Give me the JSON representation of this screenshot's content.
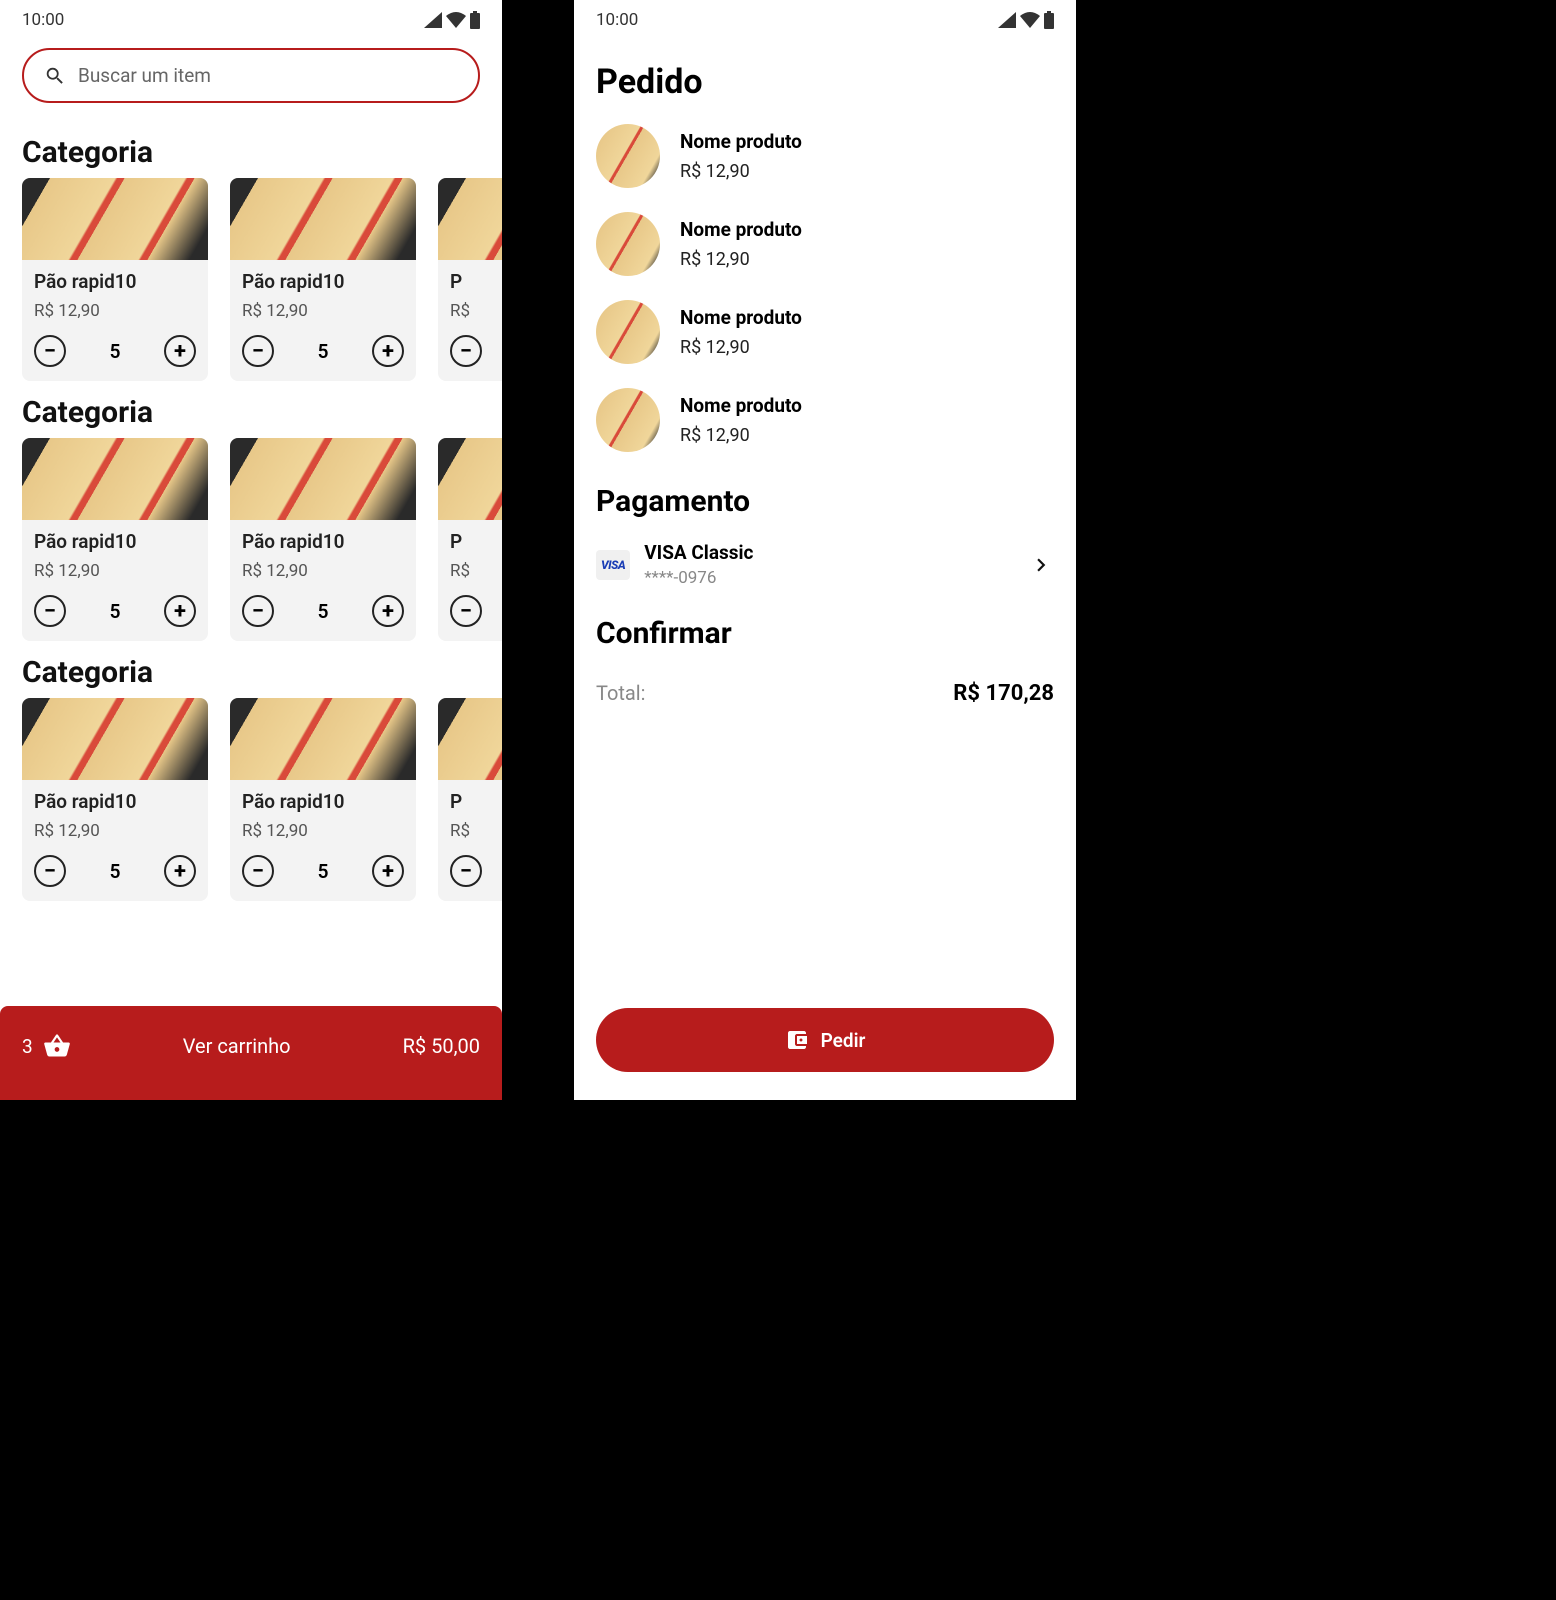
{
  "status": {
    "time": "10:00"
  },
  "search": {
    "placeholder": "Buscar um item"
  },
  "categories": [
    {
      "title": "Categoria",
      "items": [
        {
          "name": "Pão rapid10",
          "price": "R$ 12,90",
          "qty": "5"
        },
        {
          "name": "Pão rapid10",
          "price": "R$ 12,90",
          "qty": "5"
        },
        {
          "name": "P",
          "price": "R$",
          "qty": ""
        }
      ]
    },
    {
      "title": "Categoria",
      "items": [
        {
          "name": "Pão rapid10",
          "price": "R$ 12,90",
          "qty": "5"
        },
        {
          "name": "Pão rapid10",
          "price": "R$ 12,90",
          "qty": "5"
        },
        {
          "name": "P",
          "price": "R$",
          "qty": ""
        }
      ]
    },
    {
      "title": "Categoria",
      "items": [
        {
          "name": "Pão rapid10",
          "price": "R$ 12,90",
          "qty": "5"
        },
        {
          "name": "Pão rapid10",
          "price": "R$ 12,90",
          "qty": "5"
        },
        {
          "name": "P",
          "price": "R$",
          "qty": ""
        }
      ]
    }
  ],
  "cart": {
    "count": "3",
    "label": "Ver carrinho",
    "total": "R$ 50,00"
  },
  "order": {
    "title": "Pedido",
    "items": [
      {
        "name": "Nome produto",
        "price": "R$ 12,90"
      },
      {
        "name": "Nome produto",
        "price": "R$ 12,90"
      },
      {
        "name": "Nome produto",
        "price": "R$ 12,90"
      },
      {
        "name": "Nome produto",
        "price": "R$ 12,90"
      }
    ]
  },
  "payment": {
    "title": "Pagamento",
    "badge": "VISA",
    "name": "VISA Classic",
    "number": "****-0976"
  },
  "confirm": {
    "title": "Confirmar",
    "totalLabel": "Total:",
    "totalValue": "R$ 170,28",
    "button": "Pedir"
  }
}
